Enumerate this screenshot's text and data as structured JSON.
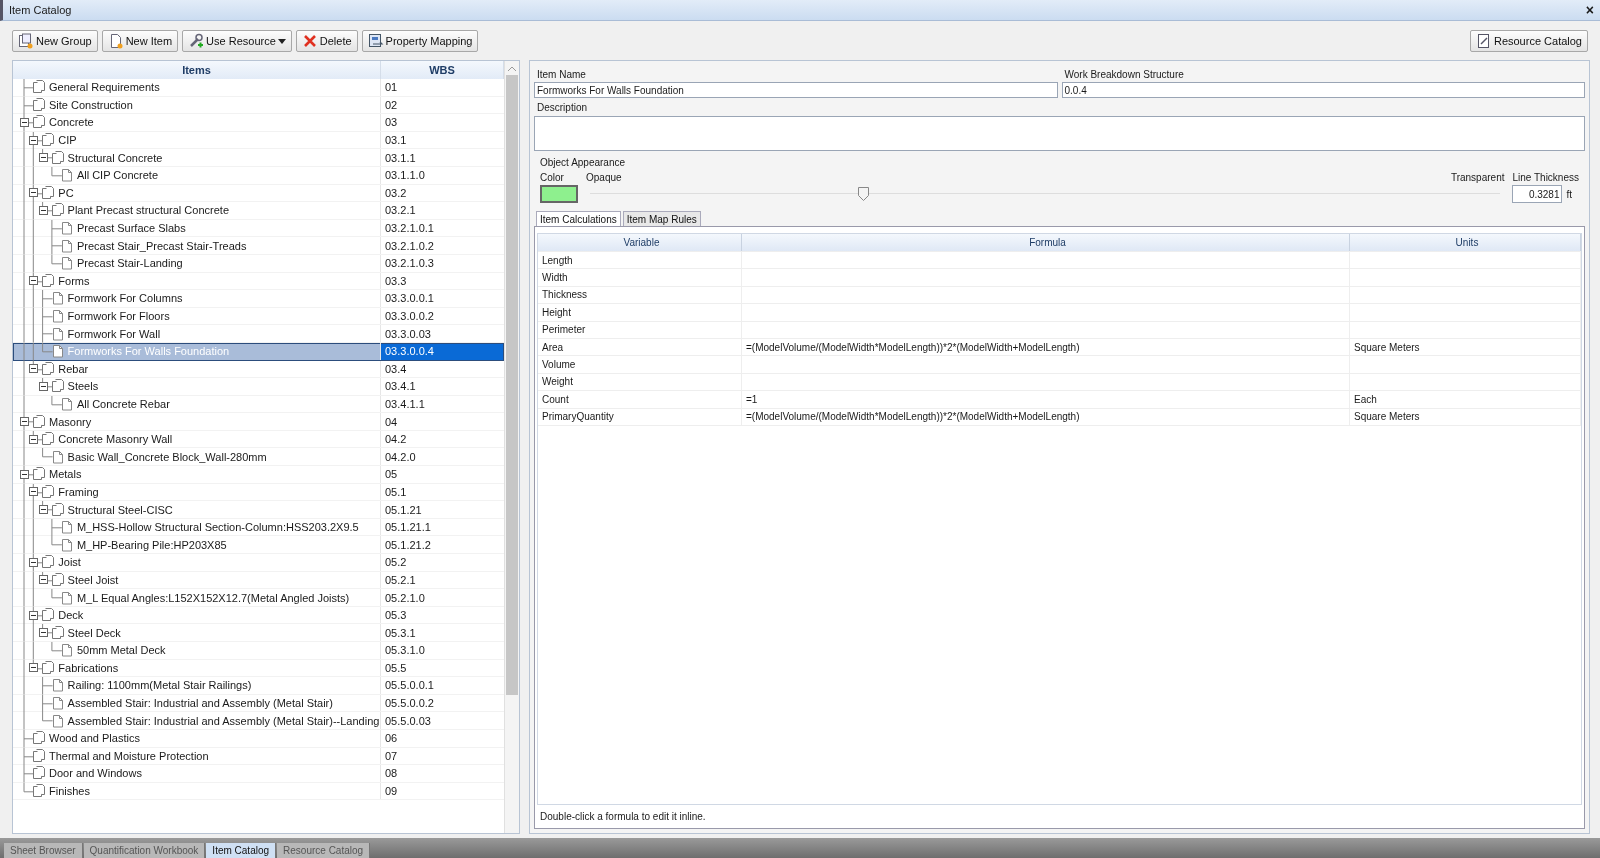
{
  "window": {
    "title": "Item Catalog",
    "close": "×"
  },
  "toolbar": [
    {
      "label": "New Group",
      "kind": "new-group"
    },
    {
      "label": "New Item",
      "kind": "new-item"
    },
    {
      "label": "Use Resource",
      "kind": "use-resource"
    },
    {
      "label": "Delete",
      "kind": "delete"
    },
    {
      "label": "Property Mapping",
      "kind": "mapping"
    }
  ],
  "resource_button": {
    "label": "Resource Catalog"
  },
  "tree": {
    "columns": [
      "Items",
      "WBS"
    ],
    "items": [
      {
        "name": "General Requirements",
        "wbs": "01",
        "kind": "group",
        "selected": false
      },
      {
        "name": "Site Construction",
        "wbs": "02",
        "kind": "group",
        "selected": false
      },
      {
        "name": "Concrete",
        "wbs": "03",
        "kind": "group",
        "selected": false,
        "expanded": true,
        "children": [
          {
            "name": "CIP",
            "wbs": "03.1",
            "kind": "group",
            "selected": false,
            "expanded": true,
            "children": [
              {
                "name": "Structural Concrete",
                "wbs": "03.1.1",
                "kind": "group",
                "selected": false,
                "expanded": true,
                "children": [
                  {
                    "name": "All CIP Concrete",
                    "wbs": "03.1.1.0",
                    "kind": "item",
                    "selected": false
                  }
                ]
              }
            ]
          },
          {
            "name": "PC",
            "wbs": "03.2",
            "kind": "group",
            "selected": false,
            "expanded": true,
            "children": [
              {
                "name": "Plant Precast structural Concrete",
                "wbs": "03.2.1",
                "kind": "group",
                "selected": false,
                "expanded": true,
                "children": [
                  {
                    "name": "Precast Surface Slabs",
                    "wbs": "03.2.1.0.1",
                    "kind": "item",
                    "selected": false
                  },
                  {
                    "name": "Precast Stair_Precast Stair-Treads",
                    "wbs": "03.2.1.0.2",
                    "kind": "item",
                    "selected": false
                  },
                  {
                    "name": "Precast Stair-Landing",
                    "wbs": "03.2.1.0.3",
                    "kind": "item",
                    "selected": false
                  }
                ]
              }
            ]
          },
          {
            "name": "Forms",
            "wbs": "03.3",
            "kind": "group",
            "selected": false,
            "expanded": true,
            "children": [
              {
                "name": "Formwork For Columns",
                "wbs": "03.3.0.0.1",
                "kind": "item",
                "selected": false
              },
              {
                "name": "Formwork For Floors",
                "wbs": "03.3.0.0.2",
                "kind": "item",
                "selected": false
              },
              {
                "name": "Formwork For Wall",
                "wbs": "03.3.0.03",
                "kind": "item",
                "selected": false
              },
              {
                "name": "Formworks For Walls Foundation",
                "wbs": "03.3.0.0.4",
                "kind": "item",
                "selected": true
              }
            ]
          },
          {
            "name": "Rebar",
            "wbs": "03.4",
            "kind": "group",
            "selected": false,
            "expanded": true,
            "children": [
              {
                "name": "Steels",
                "wbs": "03.4.1",
                "kind": "group",
                "selected": false,
                "expanded": true,
                "children": [
                  {
                    "name": "All Concrete Rebar",
                    "wbs": "03.4.1.1",
                    "kind": "item",
                    "selected": false
                  }
                ]
              }
            ]
          }
        ]
      },
      {
        "name": "Masonry",
        "wbs": "04",
        "kind": "group",
        "selected": false,
        "expanded": true,
        "children": [
          {
            "name": "Concrete Masonry Wall",
            "wbs": "04.2",
            "kind": "group",
            "selected": false,
            "expanded": true,
            "children": [
              {
                "name": "Basic Wall_Concrete Block_Wall-280mm",
                "wbs": "04.2.0",
                "kind": "item",
                "selected": false
              }
            ]
          }
        ]
      },
      {
        "name": "Metals",
        "wbs": "05",
        "kind": "group",
        "selected": false,
        "expanded": true,
        "children": [
          {
            "name": "Framing",
            "wbs": "05.1",
            "kind": "group",
            "selected": false,
            "expanded": true,
            "children": [
              {
                "name": "Structural Steel-CISC",
                "wbs": "05.1.21",
                "kind": "group",
                "selected": false,
                "expanded": true,
                "children": [
                  {
                    "name": "M_HSS-Hollow Structural Section-Column:HSS203.2X9.5",
                    "wbs": "05.1.21.1",
                    "kind": "item",
                    "selected": false
                  },
                  {
                    "name": "M_HP-Bearing Pile:HP203X85",
                    "wbs": "05.1.21.2",
                    "kind": "item",
                    "selected": false
                  }
                ]
              }
            ]
          },
          {
            "name": "Joist",
            "wbs": "05.2",
            "kind": "group",
            "selected": false,
            "expanded": true,
            "children": [
              {
                "name": "Steel Joist",
                "wbs": "05.2.1",
                "kind": "group",
                "selected": false,
                "expanded": true,
                "children": [
                  {
                    "name": "M_L Equal Angles:L152X152X12.7(Metal Angled Joists)",
                    "wbs": "05.2.1.0",
                    "kind": "item",
                    "selected": false
                  }
                ]
              }
            ]
          },
          {
            "name": "Deck",
            "wbs": "05.3",
            "kind": "group",
            "selected": false,
            "expanded": true,
            "children": [
              {
                "name": "Steel Deck",
                "wbs": "05.3.1",
                "kind": "group",
                "selected": false,
                "expanded": true,
                "children": [
                  {
                    "name": "50mm Metal Deck",
                    "wbs": "05.3.1.0",
                    "kind": "item",
                    "selected": false
                  }
                ]
              }
            ]
          },
          {
            "name": "Fabrications",
            "wbs": "05.5",
            "kind": "group",
            "selected": false,
            "expanded": true,
            "children": [
              {
                "name": "Railing: 1100mm(Metal Stair Railings)",
                "wbs": "05.5.0.0.1",
                "kind": "item",
                "selected": false
              },
              {
                "name": "Assembled Stair: Industrial and Assembly (Metal Stair)",
                "wbs": "05.5.0.0.2",
                "kind": "item",
                "selected": false
              },
              {
                "name": "Assembled Stair: Industrial and Assembly (Metal Stair)--Landing",
                "wbs": "05.5.0.03",
                "kind": "item",
                "selected": false
              }
            ]
          }
        ]
      },
      {
        "name": "Wood and Plastics",
        "wbs": "06",
        "kind": "group",
        "selected": false
      },
      {
        "name": "Thermal and Moisture Protection",
        "wbs": "07",
        "kind": "group",
        "selected": false
      },
      {
        "name": "Door and Windows",
        "wbs": "08",
        "kind": "group",
        "selected": false
      },
      {
        "name": "Finishes",
        "wbs": "09",
        "kind": "group",
        "selected": false
      }
    ]
  },
  "details": {
    "item_name_label": "Item Name",
    "item_name": "Formworks For Walls Foundation",
    "wbs_label": "Work Breakdown Structure",
    "wbs": "0.0.4",
    "description_label": "Description",
    "appearance": {
      "title": "Object Appearance",
      "color_label": "Color",
      "color": "#8ef08e",
      "opaque_label": "Opaque",
      "transparent_label": "Transparent",
      "level": 0.3,
      "thickness_label": "Line Thickness",
      "thickness": "0.3281",
      "unit": "ft"
    }
  },
  "tabs": [
    {
      "label": "Item Calculations",
      "selected": true
    },
    {
      "label": "Item Map Rules",
      "selected": false
    }
  ],
  "calculations": {
    "columns": [
      "Variable",
      "Formula",
      "Units"
    ],
    "rows": [
      [
        "Length",
        "",
        ""
      ],
      [
        "Width",
        "",
        ""
      ],
      [
        "Thickness",
        "",
        ""
      ],
      [
        "Height",
        "",
        ""
      ],
      [
        "Perimeter",
        "",
        ""
      ],
      [
        "Area",
        "=(ModelVolume/(ModelWidth*ModelLength))*2*(ModelWidth+ModelLength)",
        "Square Meters"
      ],
      [
        "Volume",
        "",
        ""
      ],
      [
        "Weight",
        "",
        ""
      ],
      [
        "Count",
        "=1",
        "Each"
      ],
      [
        "PrimaryQuantity",
        "=(ModelVolume/(ModelWidth*ModelLength))*2*(ModelWidth+ModelLength)",
        "Square Meters"
      ]
    ],
    "hint": "Double-click a formula to edit it inline."
  },
  "bottom_tabs": [
    {
      "label": "Sheet Browser",
      "selected": false
    },
    {
      "label": "Quantification Workbook",
      "selected": false
    },
    {
      "label": "Item Catalog",
      "selected": true
    },
    {
      "label": "Resource Catalog",
      "selected": false
    }
  ]
}
